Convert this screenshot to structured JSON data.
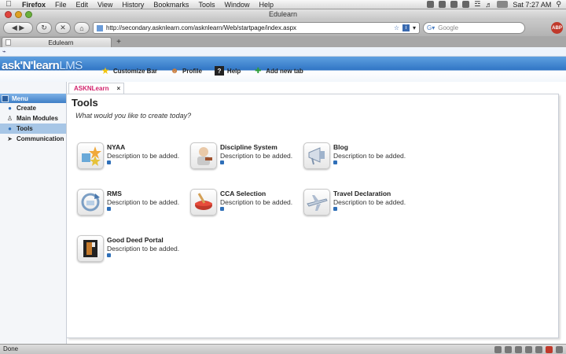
{
  "menubar": {
    "app": "Firefox",
    "items": [
      "File",
      "Edit",
      "View",
      "History",
      "Bookmarks",
      "Tools",
      "Window",
      "Help"
    ],
    "clock": "Sat 7:27 AM"
  },
  "window": {
    "title": "Edulearn"
  },
  "toolbar": {
    "url": "http://secondary.asknlearn.com/asknlearn/Web/startpage/index.aspx",
    "search_placeholder": "Google",
    "abp_label": "ABP"
  },
  "browser_tabs": [
    {
      "label": "Edulearn"
    }
  ],
  "app": {
    "logo_main": "ask'N'learn",
    "logo_lms": "LMS",
    "header_buttons": [
      {
        "label": "Customize Bar",
        "icon": "star-icon"
      },
      {
        "label": "Profile",
        "icon": "person-icon"
      },
      {
        "label": "Help",
        "icon": "help-icon"
      },
      {
        "label": "Add new tab",
        "icon": "plus-icon"
      }
    ]
  },
  "sidebar": {
    "header": "Menu",
    "items": [
      {
        "label": "Create",
        "icon": "globe-icon"
      },
      {
        "label": "Main Modules",
        "icon": "user-icon"
      },
      {
        "label": "Tools",
        "icon": "globe-icon"
      },
      {
        "label": "Communication",
        "icon": "rocket-icon"
      }
    ],
    "active": "Tools"
  },
  "page_tab": {
    "label": "ASKNLearn"
  },
  "main": {
    "title": "Tools",
    "subtitle": "What would you like to create today?",
    "tools": [
      {
        "name": "NYAA",
        "description": "Description to be added.",
        "icon": "puzzle-stars-icon"
      },
      {
        "name": "Discipline System",
        "description": "Description to be added.",
        "icon": "judge-icon"
      },
      {
        "name": "Blog",
        "description": "Description to be added.",
        "icon": "megaphone-icon"
      },
      {
        "name": "RMS",
        "description": "Description to be added.",
        "icon": "recycle-icon"
      },
      {
        "name": "CCA Selection",
        "description": "Description to be added.",
        "icon": "paint-bowl-icon"
      },
      {
        "name": "Travel Declaration",
        "description": "Description to be added.",
        "icon": "airplane-icon"
      },
      {
        "name": "Good Deed Portal",
        "description": "Description to be added.",
        "icon": "film-icon"
      }
    ]
  },
  "statusbar": {
    "text": "Done"
  }
}
